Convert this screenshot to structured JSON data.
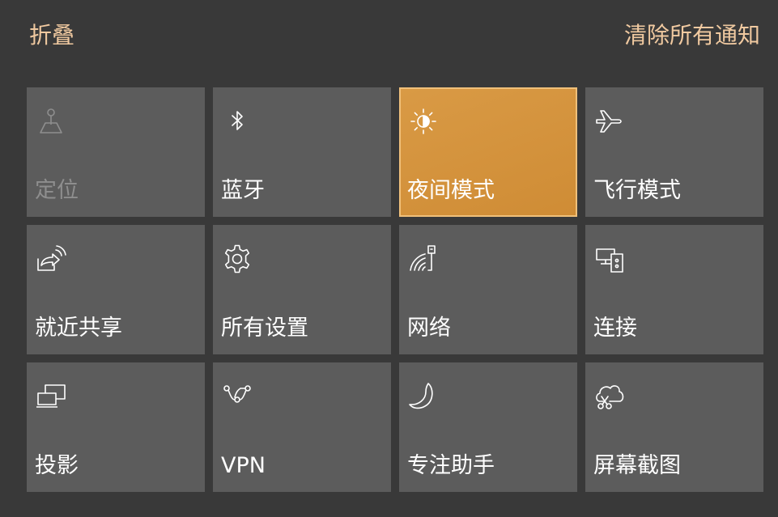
{
  "header": {
    "collapse_label": "折叠",
    "clear_all_label": "清除所有通知"
  },
  "colors": {
    "background": "#393939",
    "tile": "#5c5c5c",
    "active_tile": "#d4923c",
    "link": "#f0c9a0"
  },
  "tiles": [
    {
      "label": "定位",
      "icon": "location-icon",
      "state": "disabled"
    },
    {
      "label": "蓝牙",
      "icon": "bluetooth-icon",
      "state": "off"
    },
    {
      "label": "夜间模式",
      "icon": "night-light-icon",
      "state": "on"
    },
    {
      "label": "飞行模式",
      "icon": "airplane-icon",
      "state": "off"
    },
    {
      "label": "就近共享",
      "icon": "nearby-share-icon",
      "state": "off"
    },
    {
      "label": "所有设置",
      "icon": "gear-icon",
      "state": "off"
    },
    {
      "label": "网络",
      "icon": "network-icon",
      "state": "off"
    },
    {
      "label": "连接",
      "icon": "connect-icon",
      "state": "off"
    },
    {
      "label": "投影",
      "icon": "project-icon",
      "state": "off"
    },
    {
      "label": "VPN",
      "icon": "vpn-icon",
      "state": "off"
    },
    {
      "label": "专注助手",
      "icon": "moon-icon",
      "state": "off"
    },
    {
      "label": "屏幕截图",
      "icon": "screen-snip-icon",
      "state": "off"
    }
  ]
}
